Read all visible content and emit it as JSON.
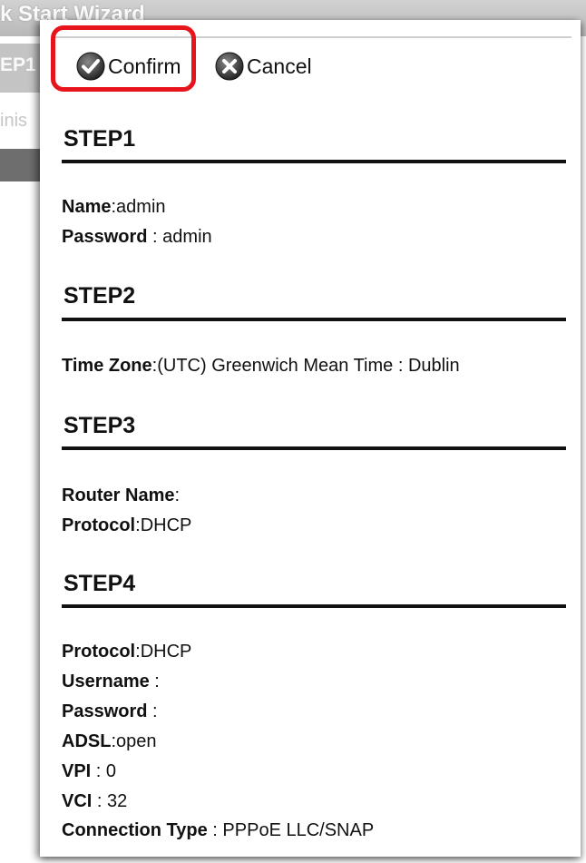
{
  "background": {
    "title_fragment": "k Start Wizard",
    "step_fragment": "EP1",
    "admin_fragment": "inis"
  },
  "toolbar": {
    "confirm_label": "Confirm",
    "cancel_label": "Cancel"
  },
  "steps": [
    {
      "title": "STEP1",
      "fields": [
        {
          "label": "Name",
          "separator": ":",
          "value": "admin"
        },
        {
          "label": "Password",
          "separator": " : ",
          "value": "admin"
        }
      ]
    },
    {
      "title": "STEP2",
      "fields": [
        {
          "label": "Time Zone",
          "separator": ":",
          "value": "(UTC) Greenwich Mean Time : Dublin"
        }
      ]
    },
    {
      "title": "STEP3",
      "fields": [
        {
          "label": "Router Name",
          "separator": ":",
          "value": ""
        },
        {
          "label": "Protocol",
          "separator": ":",
          "value": "DHCP"
        }
      ]
    },
    {
      "title": "STEP4",
      "fields": [
        {
          "label": "Protocol",
          "separator": ":",
          "value": "DHCP"
        },
        {
          "label": "Username",
          "separator": " :",
          "value": ""
        },
        {
          "label": "Password",
          "separator": " :",
          "value": ""
        },
        {
          "label": "ADSL",
          "separator": ":",
          "value": "open"
        },
        {
          "label": "VPI",
          "separator": " : ",
          "value": "0"
        },
        {
          "label": "VCI",
          "separator": " : ",
          "value": "32"
        },
        {
          "label": "Connection Type",
          "separator": " : ",
          "value": "PPPoE LLC/SNAP"
        }
      ]
    }
  ],
  "icons": {
    "confirm": "check-circle-icon",
    "cancel": "x-circle-icon"
  },
  "colors": {
    "highlight": "#e8141c",
    "text": "#111111"
  }
}
